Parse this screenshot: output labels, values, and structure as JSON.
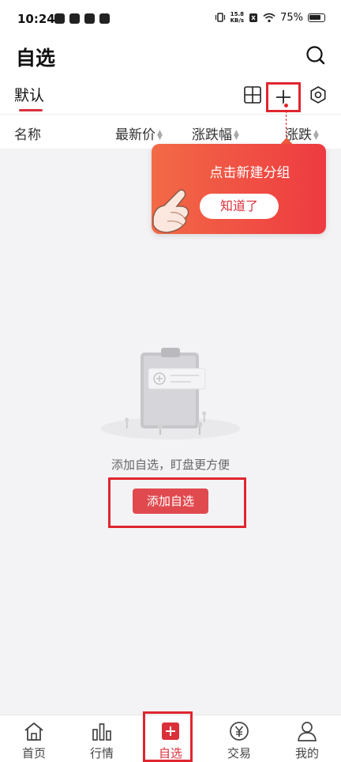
{
  "status_bar": {
    "time": "10:24",
    "net_speed_value": "15.8",
    "net_speed_unit": "KB/s",
    "battery": "75%"
  },
  "header": {
    "title": "自选"
  },
  "tabs": {
    "active": "默认"
  },
  "columns": {
    "name": "名称",
    "price": "最新价",
    "change_pct": "涨跌幅",
    "change": "涨跌"
  },
  "tooltip": {
    "text": "点击新建分组",
    "confirm_label": "知道了"
  },
  "empty_state": {
    "message": "添加自选，盯盘更方便",
    "add_button_label": "添加自选"
  },
  "bottom_nav": [
    {
      "label": "首页",
      "icon": "home-icon"
    },
    {
      "label": "行情",
      "icon": "bar-chart-icon"
    },
    {
      "label": "自选",
      "icon": "plus-square-icon",
      "active": true
    },
    {
      "label": "交易",
      "icon": "yen-coin-icon"
    },
    {
      "label": "我的",
      "icon": "person-icon"
    }
  ],
  "colors": {
    "accent": "#d9303a",
    "tooltip_gradient_start": "#f26a46",
    "tooltip_gradient_end": "#ee3a41",
    "highlight_border": "#e0262f"
  }
}
